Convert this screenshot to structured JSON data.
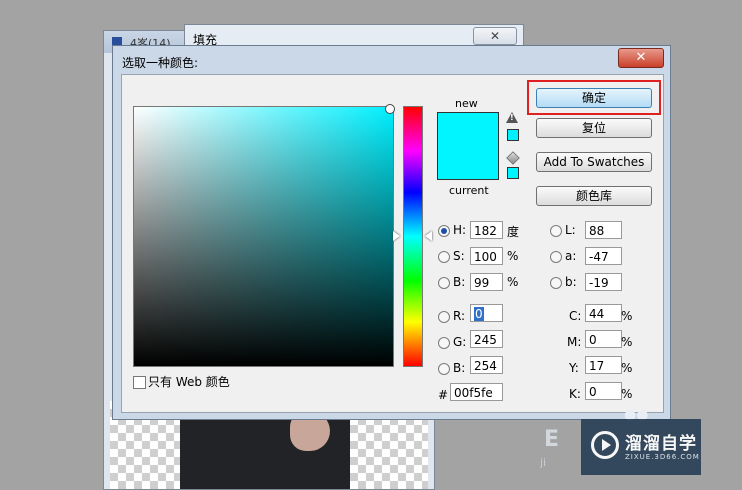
{
  "background": {
    "doc_window_title": "4峉(14)",
    "fill_window_title": "填充",
    "fill_close_symbol": "✕"
  },
  "dialog": {
    "title": "选取一种颜色:",
    "close_symbol": "✕",
    "new_label": "new",
    "current_label": "current",
    "new_color": "#00f5fe",
    "current_color": "#00f5fe",
    "web_only_label": "只有 Web 颜色",
    "buttons": {
      "ok": "确定",
      "reset": "复位",
      "add_to_swatches": "Add To Swatches",
      "color_libraries": "颜色库"
    },
    "hsb": [
      {
        "label": "H:",
        "value": "182",
        "unit": "度",
        "selected": true
      },
      {
        "label": "S:",
        "value": "100",
        "unit": "%",
        "selected": false
      },
      {
        "label": "B:",
        "value": "99",
        "unit": "%",
        "selected": false
      }
    ],
    "rgb": [
      {
        "label": "R:",
        "value": "0",
        "selected": false
      },
      {
        "label": "G:",
        "value": "245",
        "selected": false
      },
      {
        "label": "B:",
        "value": "254",
        "selected": false
      }
    ],
    "lab": [
      {
        "label": "L:",
        "value": "88"
      },
      {
        "label": "a:",
        "value": "-47"
      },
      {
        "label": "b:",
        "value": "-19"
      }
    ],
    "cmyk": [
      {
        "label": "C:",
        "value": "44",
        "unit": "%"
      },
      {
        "label": "M:",
        "value": "0",
        "unit": "%"
      },
      {
        "label": "Y:",
        "value": "17",
        "unit": "%"
      },
      {
        "label": "K:",
        "value": "0",
        "unit": "%"
      }
    ],
    "hex_label": "#",
    "hex_value": "00f5fe"
  },
  "watermark": {
    "brand": "溜溜自学",
    "site": "ZIXUE.3D66.COM",
    "partial_e": "E",
    "partial_j": "ji",
    "dots": "●●"
  },
  "colors": {
    "highlight": "#e02020",
    "ok_button": "#b3dcf5"
  }
}
